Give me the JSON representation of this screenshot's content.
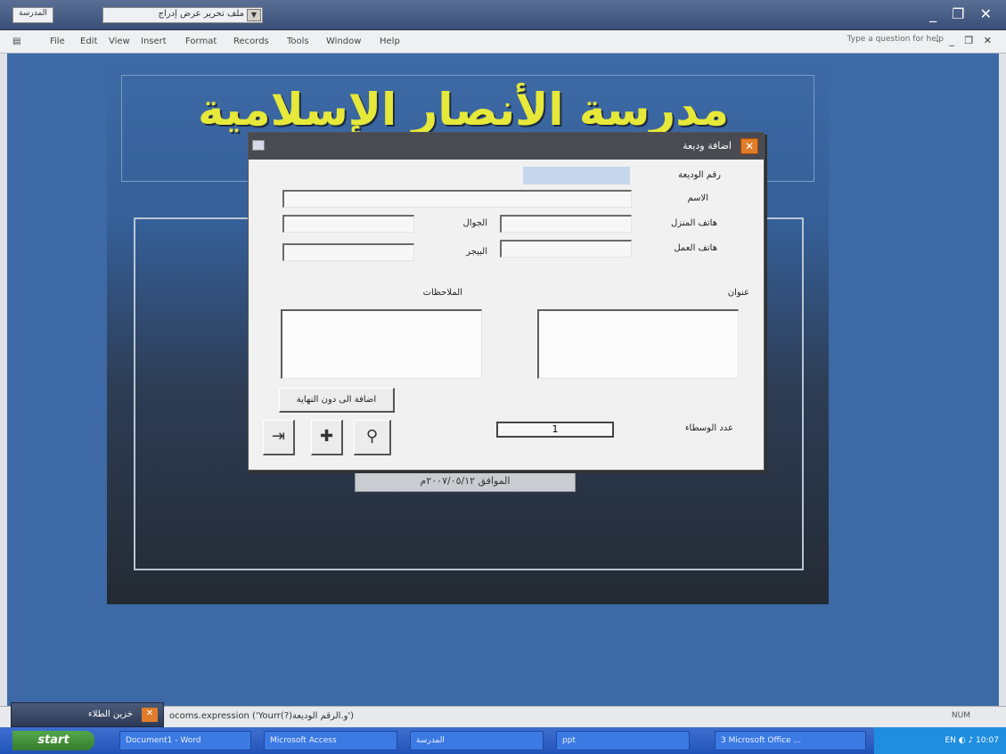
{
  "titlebar": {
    "left_box": "ﺍﻟﻤﺪﺭﺳﺔ",
    "combo_value": "ﻣﻠﻒ ﺗﺤﺮﻳﺮ ﻋﺮﺽ ﺇﺩﺭﺍﺝ",
    "controls": "_ ❐ ✕"
  },
  "menu": {
    "items": [
      "File",
      "Edit",
      "View",
      "Insert",
      "Format",
      "Records",
      "Tools",
      "Window",
      "Help"
    ],
    "help_box": "Type a question for help",
    "mdi_controls": "- _ ❐ ✕"
  },
  "school": {
    "banner_title": "مدرسة الأنصار الإسلامية",
    "date_text": "الموافق ٢٠٠٧/٠٥/١٢م"
  },
  "dialog": {
    "title": "اضافة وديعة",
    "close": "✕",
    "labels": {
      "deposit_no": "رقم الوديعة",
      "name": "الاسم",
      "home_phone": "هاتف المنزل",
      "mobile": "الجوال",
      "work_phone": "هاتف العمل",
      "pager": "البيجر",
      "address": "عنوان",
      "notes": "الملاحظات",
      "donors_count": "عدد الوسطاء"
    },
    "add_button": "اضافة الى دون النهاية",
    "count_value": "1",
    "icons": {
      "exit": "⇥",
      "add": "✚",
      "search": "⚲"
    }
  },
  "status": {
    "text": "ocoms.expression ('Yourr(?)و.الرقم الوديعة')",
    "num": "NUM"
  },
  "minimized_window": {
    "title": "خزين الطلاء",
    "close": "✕"
  },
  "taskbar": {
    "start": "start",
    "tasks": [
      "Document1 - Word",
      "Microsoft Access",
      "المدرسة",
      "ppt",
      "3 Microsoft Office ..."
    ],
    "tray": "EN  ◐ ♪  10:07"
  }
}
